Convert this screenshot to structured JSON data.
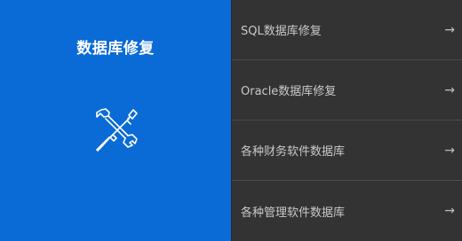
{
  "left_panel": {
    "title": "数据库修复",
    "icon": "tools-icon",
    "background": "#0a6bd6"
  },
  "menu": {
    "background": "#333333",
    "items": [
      {
        "label": "SQL数据库修复",
        "icon": "arrow-right-icon"
      },
      {
        "label": "Oracle数据库修复",
        "icon": "arrow-right-icon"
      },
      {
        "label": "各种财务软件数据库",
        "icon": "arrow-right-icon"
      },
      {
        "label": "各种管理软件数据库",
        "icon": "arrow-right-icon"
      }
    ]
  }
}
